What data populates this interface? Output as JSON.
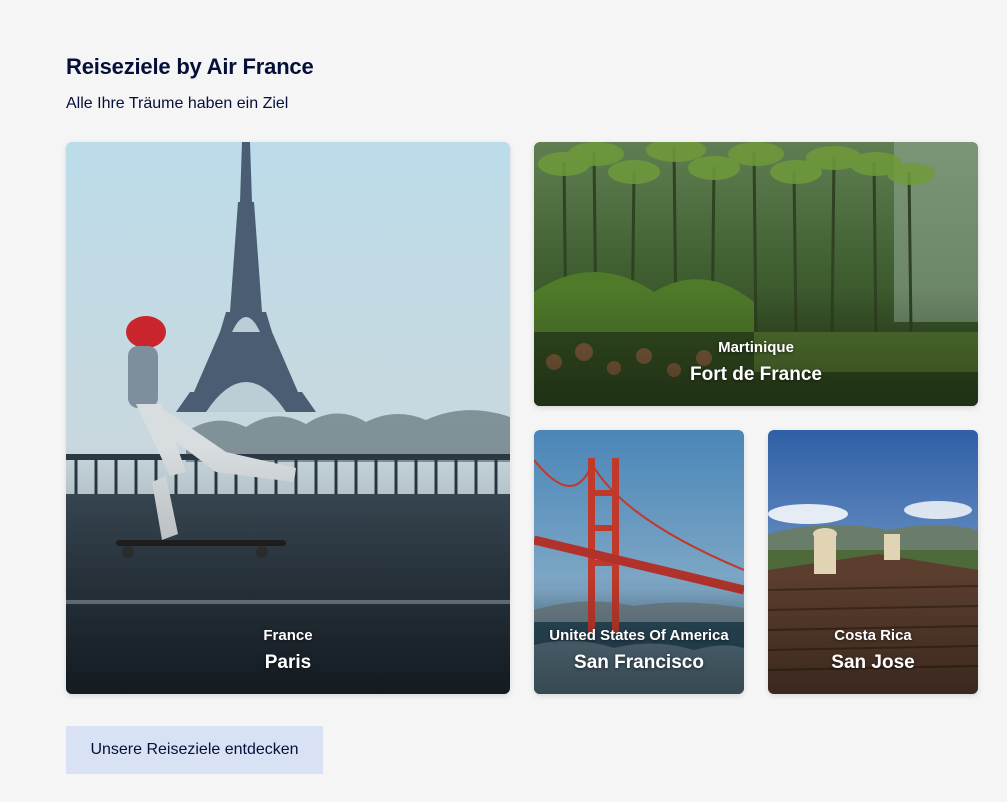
{
  "section": {
    "title": "Reiseziele by Air France",
    "subtitle": "Alle Ihre Träume haben ein Ziel"
  },
  "destinations": [
    {
      "country": "France",
      "city": "Paris"
    },
    {
      "country": "Martinique",
      "city": "Fort de France"
    },
    {
      "country": "United States Of America",
      "city": "San Francisco"
    },
    {
      "country": "Costa Rica",
      "city": "San Jose"
    }
  ],
  "cta": {
    "label": "Unsere Reiseziele entdecken"
  },
  "colors": {
    "text": "#051039",
    "background": "#f5f5f6",
    "button_bg": "#d8e2f4"
  }
}
